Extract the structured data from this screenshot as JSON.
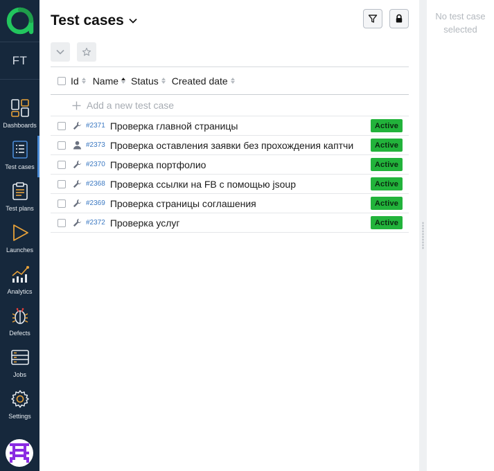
{
  "sidebar": {
    "project_code": "FT",
    "items": [
      {
        "label": "Dashboards",
        "icon": "dashboards-icon",
        "active": false
      },
      {
        "label": "Test cases",
        "icon": "test-cases-icon",
        "active": true
      },
      {
        "label": "Test plans",
        "icon": "test-plans-icon",
        "active": false
      },
      {
        "label": "Launches",
        "icon": "launches-icon",
        "active": false
      },
      {
        "label": "Analytics",
        "icon": "analytics-icon",
        "active": false
      },
      {
        "label": "Defects",
        "icon": "defects-icon",
        "active": false
      },
      {
        "label": "Jobs",
        "icon": "jobs-icon",
        "active": false
      },
      {
        "label": "Settings",
        "icon": "settings-icon",
        "active": false
      }
    ],
    "colors": {
      "background": "#16283c",
      "logo": "#22c55e",
      "active_indicator": "#4a8bd6",
      "icon_accent": "#e8a23a"
    }
  },
  "main": {
    "title": "Test cases",
    "columns": {
      "id": "Id",
      "name": "Name",
      "status": "Status",
      "created": "Created date"
    },
    "add_placeholder": "Add a new test case",
    "rows": [
      {
        "id": "#2371",
        "name": "Проверка главной страницы",
        "status": "Active",
        "type_icon": "wrench-icon"
      },
      {
        "id": "#2373",
        "name": "Проверка оставления заявки без прохождения каптчи",
        "status": "Active",
        "type_icon": "person-icon"
      },
      {
        "id": "#2370",
        "name": "Проверка портфолио",
        "status": "Active",
        "type_icon": "wrench-icon"
      },
      {
        "id": "#2368",
        "name": "Проверка ссылки на FB с помощью jsoup",
        "status": "Active",
        "type_icon": "wrench-icon"
      },
      {
        "id": "#2369",
        "name": "Проверка страницы соглашения",
        "status": "Active",
        "type_icon": "wrench-icon"
      },
      {
        "id": "#2372",
        "name": "Проверка услуг",
        "status": "Active",
        "type_icon": "wrench-icon"
      }
    ],
    "colors": {
      "status_active": "#22b33b",
      "id_link": "#3a78c2"
    }
  },
  "detail": {
    "empty_text": "No test case selected"
  }
}
